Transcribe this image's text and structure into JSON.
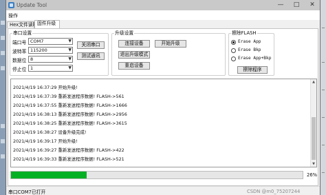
{
  "window": {
    "title": "Update Tool"
  },
  "menu": {
    "operate": "操作"
  },
  "tabs": [
    {
      "label": "Hex文件读取"
    },
    {
      "label": "固件升级"
    }
  ],
  "serial": {
    "group_title": "串口设置",
    "port_label": "端口号",
    "port_value": "COM7",
    "baud_label": "波特率",
    "baud_value": "115200",
    "databits_label": "数据位",
    "databits_value": "8",
    "stopbits_label": "停止位",
    "stopbits_value": "1",
    "close_port_button": "关闭串口",
    "test_comm_button": "测试通讯"
  },
  "upgrade": {
    "group_title": "升级设置",
    "connect_button": "连接设备",
    "start_button": "开始升级",
    "exit_mode_button": "退出升级模式",
    "reset_button": "重启设备"
  },
  "erase": {
    "group_title": "擦除FLASH",
    "options": [
      {
        "label": "Erase App",
        "selected": true
      },
      {
        "label": "Erase Bkp",
        "selected": false
      },
      {
        "label": "Erase App+Bkp",
        "selected": false
      }
    ],
    "erase_button": "擦除程序"
  },
  "log": {
    "lines": [
      "2021/4/19 16:37:29 开始升级!",
      "2021/4/19 16:37:39 重新发送程序数据! FLASH->561",
      "2021/4/19 16:37:55 重新发送程序数据! FLASH->1666",
      "2021/4/19 16:38:13 重新发送程序数据! FLASH->2956",
      "2021/4/19 16:38:25 重新发送程序数据! FLASH->3615",
      "2021/4/19 16:38:27 设备升级完成!",
      "2021/4/19 16:39:17 开始升级!",
      "2021/4/19 16:39:27 重新发送程序数据! FLASH->422",
      "2021/4/19 16:39:33 重新发送程序数据! FLASH->521"
    ]
  },
  "progress": {
    "percent": 26,
    "label": "26%",
    "color": "#06b025"
  },
  "status": {
    "text": "串口COM7已打开",
    "watermark": "CSDN @m0_75207244"
  }
}
